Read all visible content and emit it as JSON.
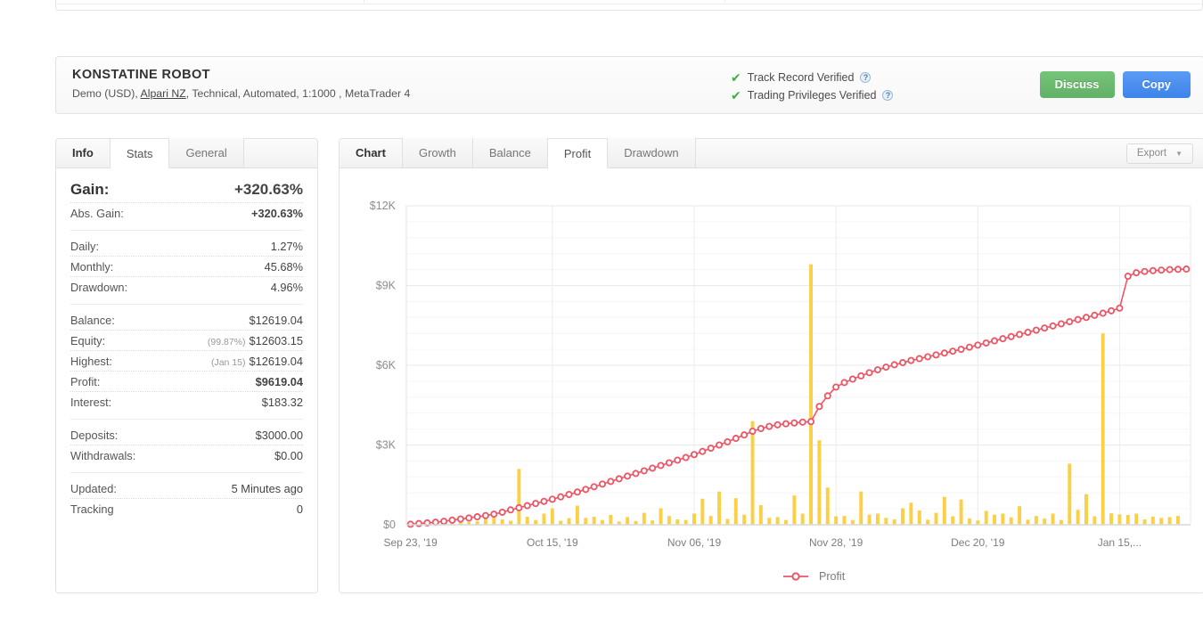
{
  "header": {
    "title": "KONSTATINE ROBOT",
    "subtitle_pre": "Demo (USD), ",
    "broker_link": "Alpari NZ",
    "subtitle_post": ", Technical, Automated, 1:1000 , MetaTrader 4",
    "verifications": [
      {
        "label": "Track Record Verified",
        "icon": "check-icon",
        "help": "?"
      },
      {
        "label": "Trading Privileges Verified",
        "icon": "check-icon",
        "help": "?"
      }
    ],
    "discuss_label": "Discuss",
    "copy_label": "Copy",
    "accent_green": "#63b168",
    "accent_blue": "#3d83ea",
    "check_color": "#3fae49"
  },
  "stats_panel": {
    "tabs": [
      {
        "label": "Info",
        "active": false,
        "bold": true
      },
      {
        "label": "Stats",
        "active": true,
        "bold": false
      },
      {
        "label": "General",
        "active": false,
        "bold": false
      }
    ],
    "groups": [
      [
        {
          "label": "Gain:",
          "value": "+320.63%",
          "style": "big-green"
        },
        {
          "label": "Abs. Gain:",
          "value": "+320.63%",
          "style": "green"
        }
      ],
      [
        {
          "label": "Daily:",
          "value": "1.27%",
          "style": "plain"
        },
        {
          "label": "Monthly:",
          "value": "45.68%",
          "style": "plain"
        },
        {
          "label": "Drawdown:",
          "value": "4.96%",
          "style": "plain"
        }
      ],
      [
        {
          "label": "Balance:",
          "value": "$12619.04",
          "style": "plain",
          "note": ""
        },
        {
          "label": "Equity:",
          "value": "$12603.15",
          "style": "plain",
          "note": "(99.87%)"
        },
        {
          "label": "Highest:",
          "value": "$12619.04",
          "style": "plain",
          "note": "(Jan 15)"
        },
        {
          "label": "Profit:",
          "value": "$9619.04",
          "style": "green",
          "note": ""
        },
        {
          "label": "Interest:",
          "value": "$183.32",
          "style": "plain",
          "note": ""
        }
      ],
      [
        {
          "label": "Deposits:",
          "value": "$3000.00",
          "style": "plain"
        },
        {
          "label": "Withdrawals:",
          "value": "$0.00",
          "style": "plain"
        }
      ],
      [
        {
          "label": "Updated:",
          "value": "5 Minutes ago",
          "style": "plain"
        },
        {
          "label": "Tracking",
          "value": "0",
          "style": "plain"
        }
      ]
    ],
    "green_hex": "#2eae3c"
  },
  "chart_panel": {
    "tabs": [
      {
        "label": "Chart",
        "active": false,
        "bold": true
      },
      {
        "label": "Growth",
        "active": false,
        "bold": false
      },
      {
        "label": "Balance",
        "active": false,
        "bold": false
      },
      {
        "label": "Profit",
        "active": true,
        "bold": false
      },
      {
        "label": "Drawdown",
        "active": false,
        "bold": false
      }
    ],
    "export_label": "Export",
    "export_caret": "▼"
  },
  "chart_data": {
    "type": "line",
    "title": "",
    "xlabel": "",
    "ylabel": "",
    "ylim": [
      0,
      12000
    ],
    "yticks": [
      0,
      3000,
      6000,
      9000,
      12000
    ],
    "ytick_labels": [
      "$0",
      "$3K",
      "$6K",
      "$9K",
      "$12K"
    ],
    "grid": true,
    "minor_grid_step": 600,
    "legend": [
      {
        "name": "Profit",
        "color": "#ED5565",
        "marker": "circle"
      }
    ],
    "legend_position": "bottom-center",
    "xtick_labels": [
      "Sep 23, '19",
      "Oct 15, '19",
      "Nov 06, '19",
      "Nov 28, '19",
      "Dec 20, '19",
      "Jan 15,..."
    ],
    "xtick_indices": [
      0,
      17,
      34,
      51,
      68,
      85
    ],
    "series": [
      {
        "name": "Profit",
        "type": "line",
        "color": "#ED5565",
        "marker": "circle",
        "values": [
          20,
          45,
          70,
          95,
          130,
          175,
          215,
          255,
          300,
          345,
          400,
          470,
          560,
          640,
          720,
          800,
          880,
          960,
          1050,
          1140,
          1230,
          1330,
          1430,
          1530,
          1630,
          1730,
          1830,
          1930,
          2030,
          2130,
          2230,
          2330,
          2430,
          2530,
          2640,
          2760,
          2880,
          3000,
          3120,
          3250,
          3380,
          3520,
          3620,
          3700,
          3760,
          3800,
          3830,
          3860,
          3880,
          4450,
          4850,
          5180,
          5350,
          5480,
          5600,
          5720,
          5830,
          5930,
          6020,
          6100,
          6180,
          6250,
          6320,
          6390,
          6460,
          6530,
          6600,
          6680,
          6760,
          6840,
          6920,
          7000,
          7080,
          7160,
          7240,
          7320,
          7400,
          7480,
          7560,
          7640,
          7720,
          7800,
          7880,
          7960,
          8050,
          8150,
          9350,
          9480,
          9530,
          9560,
          9580,
          9600,
          9610,
          9619
        ]
      },
      {
        "name": "Daily Profit Bars",
        "type": "bar",
        "color": "#FBD046",
        "values": [
          30,
          40,
          55,
          60,
          70,
          80,
          95,
          110,
          130,
          250,
          480,
          200,
          150,
          2100,
          300,
          180,
          420,
          620,
          150,
          250,
          720,
          260,
          300,
          180,
          370,
          120,
          290,
          140,
          450,
          160,
          620,
          330,
          200,
          180,
          420,
          980,
          330,
          1250,
          220,
          1000,
          380,
          3900,
          740,
          260,
          290,
          180,
          1100,
          420,
          9800,
          3180,
          1400,
          320,
          330,
          180,
          1250,
          380,
          420,
          260,
          200,
          620,
          830,
          540,
          190,
          450,
          1050,
          320,
          950,
          240,
          160,
          520,
          380,
          420,
          280,
          700,
          190,
          330,
          230,
          420,
          180,
          2300,
          560,
          1150,
          320,
          7200,
          430,
          390,
          370,
          420,
          200,
          310,
          260,
          290,
          330
        ]
      }
    ]
  }
}
